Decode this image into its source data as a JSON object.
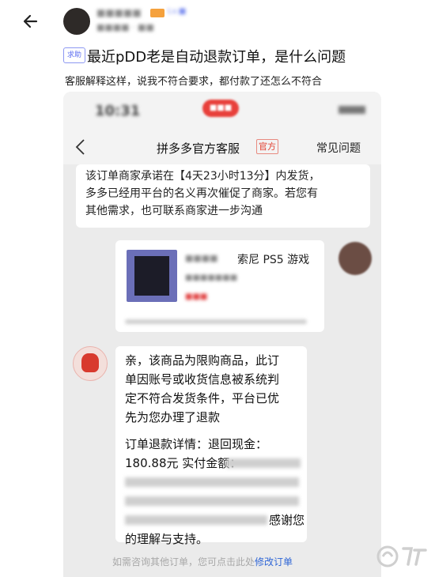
{
  "post": {
    "title": "最近pDD老是自动退款订单，是什么问题",
    "tag": "求助",
    "subtitle": "客服解释这样，说我不符合要求，都付款了还怎么不符合"
  },
  "author": {
    "name": "■■■■■",
    "level": "Lv.■",
    "meta": "■■■■ · ■■"
  },
  "chat": {
    "status_time": "10:31",
    "status_pill": "■■■",
    "nav": {
      "title": "拼多多官方客服",
      "tag": "官方",
      "faq": "常见问题"
    },
    "notice_lines": [
      "该订单商家承诺在【4天23小时13分】内发货，",
      "多多已经用平台的名义再次催促了商家。若您有",
      "其他需求，也可联系商家进一步沟通"
    ],
    "product": {
      "name_blur": "■■■■",
      "title": "索尼 PS5 游戏",
      "sub_blur": "■■■■■■■",
      "price_blur": "■■■"
    },
    "reply_lines": [
      "亲，该商品为限购商品，此订",
      "单因账号或收货信息被系统判",
      "定不符合发货条件，平台已优",
      "先为您办理了退款",
      "",
      "订单退款详情：退回现金：",
      "180.88元 实付金额：",
      "",
      "",
      "感谢您",
      "的理解与支持。"
    ],
    "footer": {
      "text": "如需咨询其他订单，您可点击此处",
      "link": "修改订单"
    }
  },
  "colors": {
    "link": "#2f66d6",
    "official": "#e23c2c",
    "tag": "#5b6cf0"
  },
  "icons": {
    "back": "back-arrow-icon",
    "watermark": "jiuyou-logo-icon"
  }
}
